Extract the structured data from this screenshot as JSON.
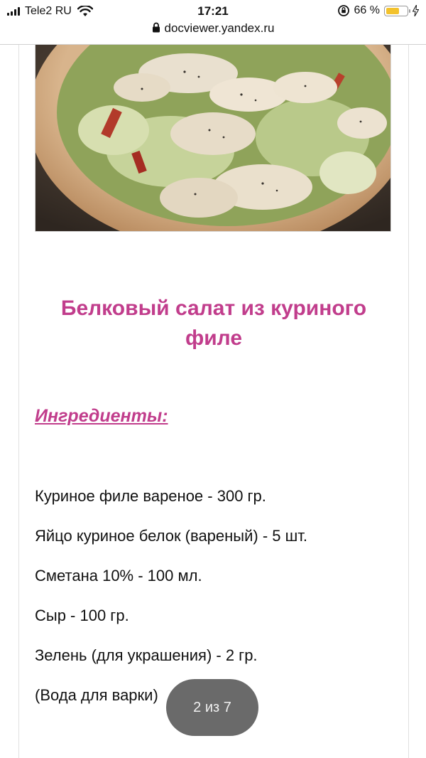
{
  "status_bar": {
    "carrier": "Tele2 RU",
    "time": "17:21",
    "battery_percent_text": "66 %",
    "battery_level": 0.66,
    "icons": [
      "signal-bars-icon",
      "wifi-icon",
      "rotation-lock-icon",
      "battery-icon",
      "charging-bolt-icon"
    ]
  },
  "browser": {
    "url": "docviewer.yandex.ru"
  },
  "document": {
    "image_alt": "",
    "title": "Белковый салат из куриного филе",
    "ingredients_heading": "Ингредиенты:",
    "ingredients": [
      "Куриное филе вареное - 300 гр.",
      "Яйцо куриное белок (вареный) - 5 шт.",
      "Сметана 10% - 100 мл.",
      "Сыр - 100 гр.",
      "Зелень (для украшения) - 2 гр.",
      "(Вода для варки)"
    ]
  },
  "viewer": {
    "page_indicator": "2 из 7"
  },
  "colors": {
    "accent": "#c13d8c",
    "battery": "#f3c22c"
  }
}
